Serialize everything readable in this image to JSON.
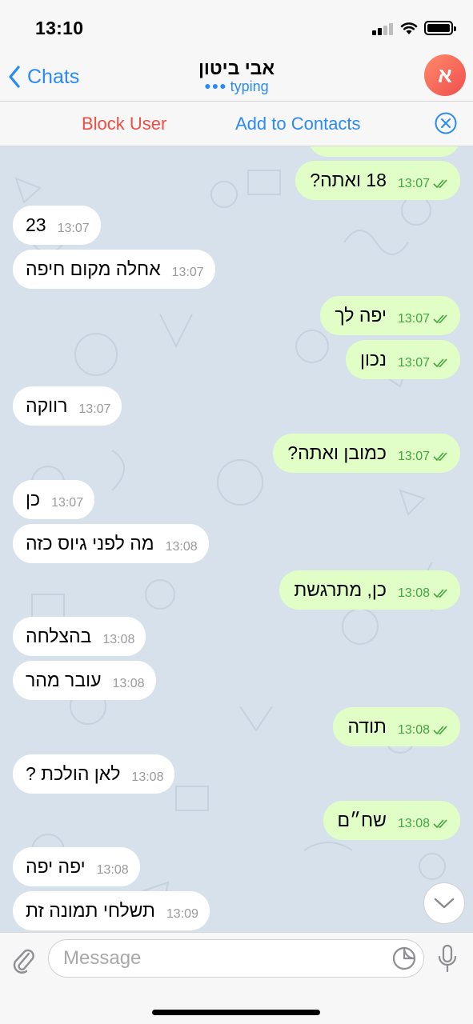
{
  "status": {
    "time": "13:10"
  },
  "nav": {
    "back_label": "Chats",
    "title": "אבי ביטון",
    "subtitle": "typing",
    "avatar_initial": "א"
  },
  "actions": {
    "block_label": "Block User",
    "add_label": "Add to Contacts"
  },
  "messages": [
    {
      "dir": "out",
      "text": "18 ואתה?",
      "time": "13:07",
      "read": true
    },
    {
      "dir": "in",
      "text": "23",
      "time": "13:07"
    },
    {
      "dir": "in",
      "text": "אחלה מקום חיפה",
      "time": "13:07"
    },
    {
      "dir": "out",
      "text": "יפה לך",
      "time": "13:07",
      "read": true
    },
    {
      "dir": "out",
      "text": "נכון",
      "time": "13:07",
      "read": true
    },
    {
      "dir": "in",
      "text": "רווקה",
      "time": "13:07"
    },
    {
      "dir": "out",
      "text": "כמובן ואתה?",
      "time": "13:07",
      "read": true
    },
    {
      "dir": "in",
      "text": "כן",
      "time": "13:07"
    },
    {
      "dir": "in",
      "text": "מה לפני גיוס כזה",
      "time": "13:08"
    },
    {
      "dir": "out",
      "text": "כן, מתרגשת",
      "time": "13:08",
      "read": true
    },
    {
      "dir": "in",
      "text": "בהצלחה",
      "time": "13:08"
    },
    {
      "dir": "in",
      "text": "עובר מהר",
      "time": "13:08"
    },
    {
      "dir": "out",
      "text": "תודה",
      "time": "13:08",
      "read": true
    },
    {
      "dir": "in",
      "text": "לאן הולכת ?",
      "time": "13:08"
    },
    {
      "dir": "out",
      "text": "שח״ם",
      "time": "13:08",
      "read": true
    },
    {
      "dir": "in",
      "text": "יפה יפה",
      "time": "13:08"
    },
    {
      "dir": "in",
      "text": "תשלחי תמונה זת",
      "time": "13:09"
    }
  ],
  "input": {
    "placeholder": "Message",
    "value": ""
  },
  "icons": {
    "back": "chevron-left-icon",
    "close": "close-circle-icon",
    "attach": "paperclip-icon",
    "sticker": "sticker-icon",
    "mic": "microphone-icon",
    "scroll": "chevron-down-icon"
  },
  "colors": {
    "accent": "#2a8af6",
    "danger": "#f04e43",
    "outgoing": "#e1fec6",
    "incoming": "#ffffff",
    "chat_bg": "#d6e1ec",
    "read_check": "#42a540"
  }
}
